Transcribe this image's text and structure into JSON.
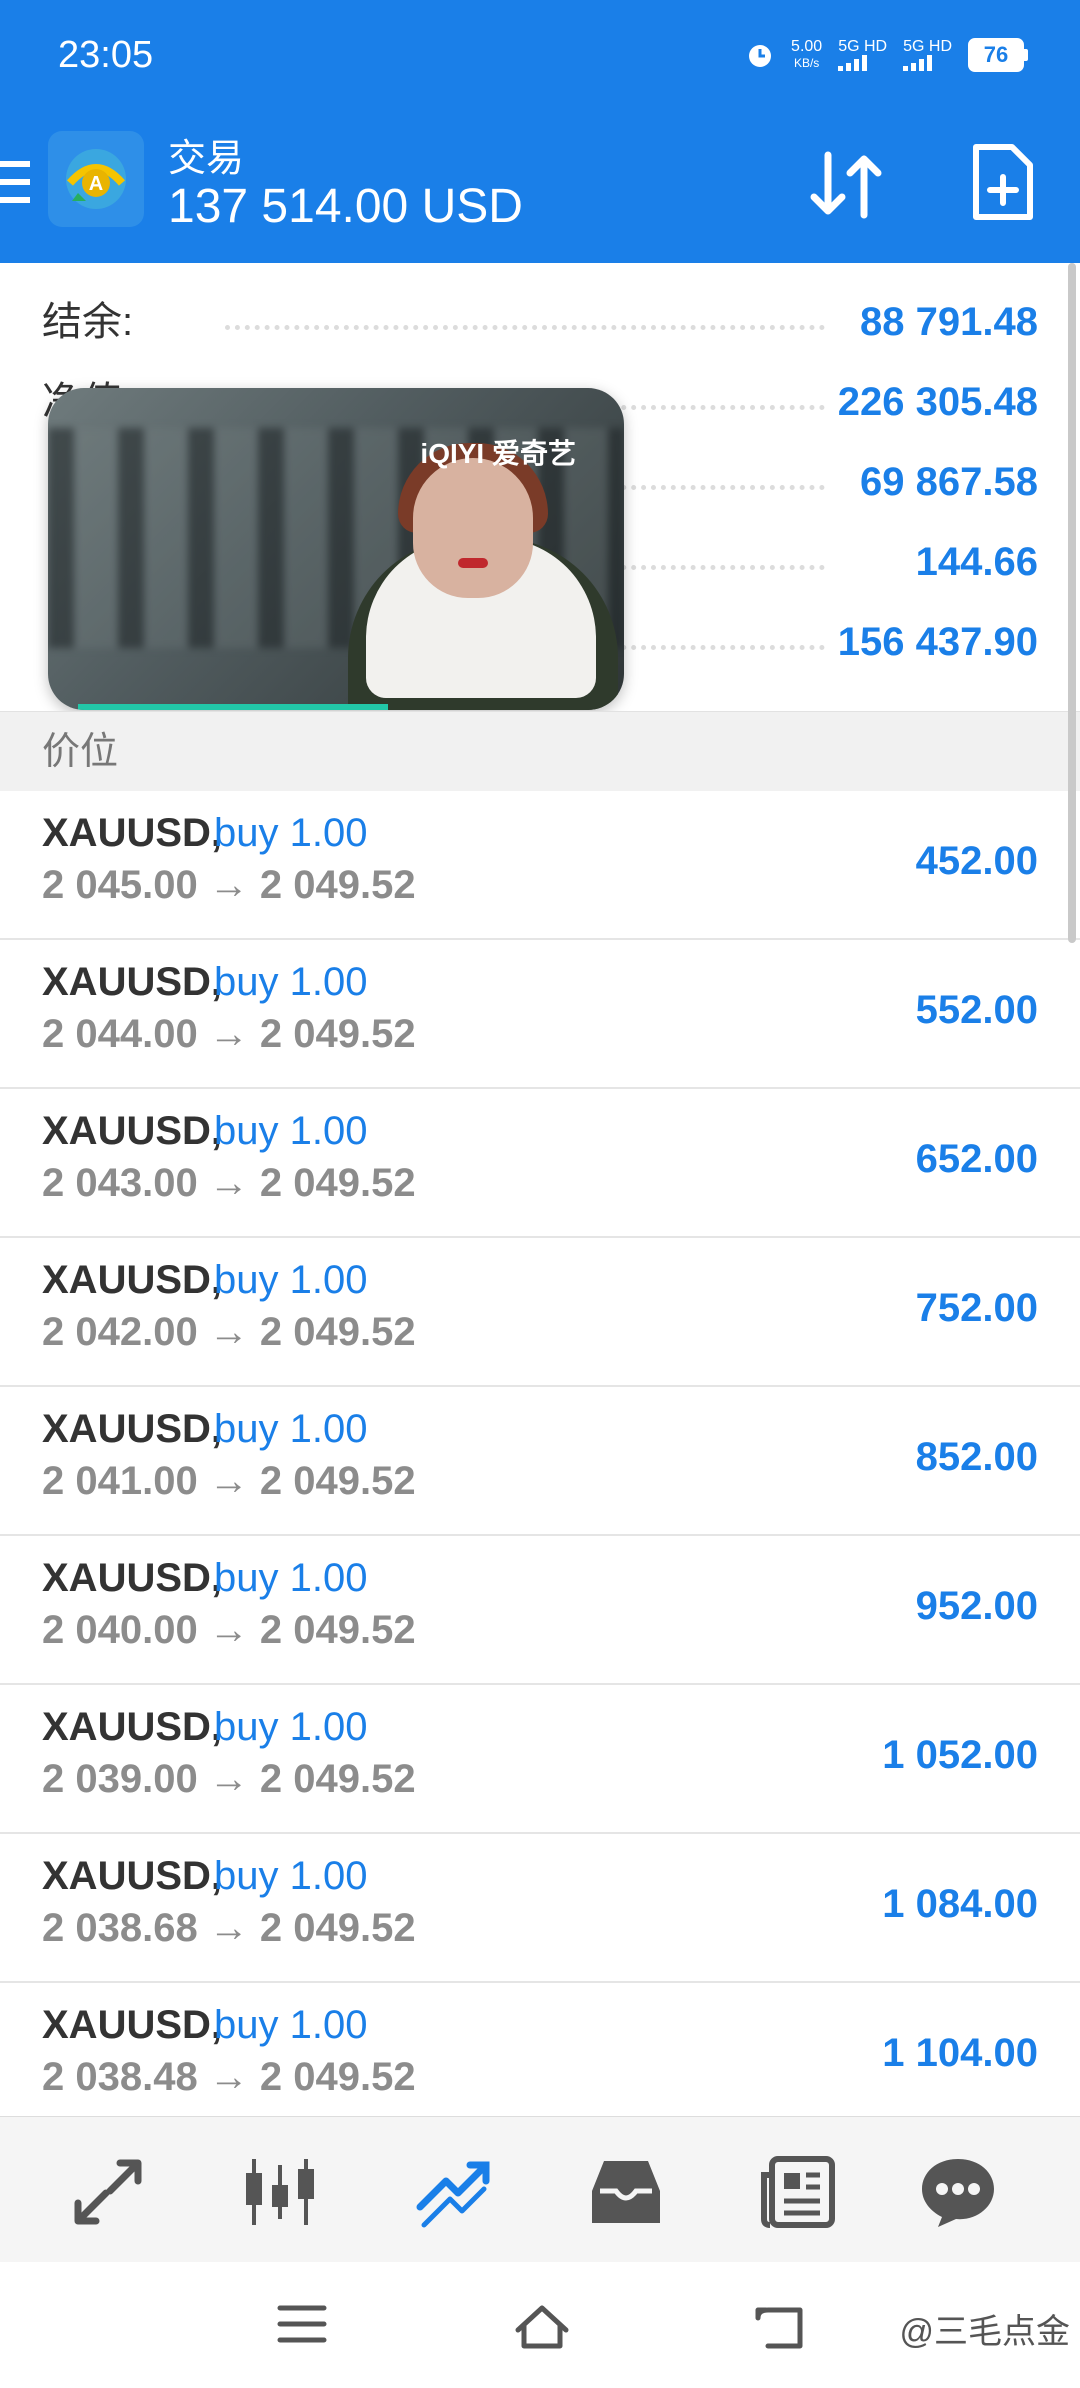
{
  "status_bar": {
    "time": "23:05",
    "net_speed": "5.00",
    "net_speed_unit": "KB/s",
    "sim1": "5G HD",
    "sim2": "5G HD",
    "battery": "76"
  },
  "header": {
    "title": "交易",
    "equity": "137 514.00 USD",
    "icons": [
      "menu-icon",
      "app-logo",
      "sort-icon",
      "new-order-icon"
    ]
  },
  "summary": {
    "rows": [
      {
        "label": "结余:",
        "value": "88 791.48"
      },
      {
        "label": "净值:",
        "value": "226 305.48"
      },
      {
        "label": "",
        "value": "69 867.58"
      },
      {
        "label": "",
        "value": "144.66"
      },
      {
        "label": "",
        "value": "156 437.90"
      }
    ]
  },
  "video_overlay": {
    "brand": "iQIYI 爱奇艺"
  },
  "price_header": "价位",
  "trades": [
    {
      "symbol": "XAUUSD,",
      "type": "buy 1.00",
      "prices": "2 045.00 → 2 049.52",
      "profit": "452.00"
    },
    {
      "symbol": "XAUUSD,",
      "type": "buy 1.00",
      "prices": "2 044.00 → 2 049.52",
      "profit": "552.00"
    },
    {
      "symbol": "XAUUSD,",
      "type": "buy 1.00",
      "prices": "2 043.00 → 2 049.52",
      "profit": "652.00"
    },
    {
      "symbol": "XAUUSD,",
      "type": "buy 1.00",
      "prices": "2 042.00 → 2 049.52",
      "profit": "752.00"
    },
    {
      "symbol": "XAUUSD,",
      "type": "buy 1.00",
      "prices": "2 041.00 → 2 049.52",
      "profit": "852.00"
    },
    {
      "symbol": "XAUUSD,",
      "type": "buy 1.00",
      "prices": "2 040.00 → 2 049.52",
      "profit": "952.00"
    },
    {
      "symbol": "XAUUSD,",
      "type": "buy 1.00",
      "prices": "2 039.00 → 2 049.52",
      "profit": "1 052.00"
    },
    {
      "symbol": "XAUUSD,",
      "type": "buy 1.00",
      "prices": "2 038.68 → 2 049.52",
      "profit": "1 084.00"
    },
    {
      "symbol": "XAUUSD,",
      "type": "buy 1.00",
      "prices": "2 038.48 → 2 049.52",
      "profit": "1 104.00"
    }
  ],
  "bottom_nav": [
    "quotes-icon",
    "chart-icon",
    "trade-icon",
    "history-icon",
    "news-icon",
    "messages-icon"
  ],
  "bottom_nav_active": "trade-icon",
  "watermark": "@三毛点金",
  "colors": {
    "accent": "#1a7fe8",
    "profit": "#1a7fe8",
    "muted": "#8c8c8c"
  }
}
